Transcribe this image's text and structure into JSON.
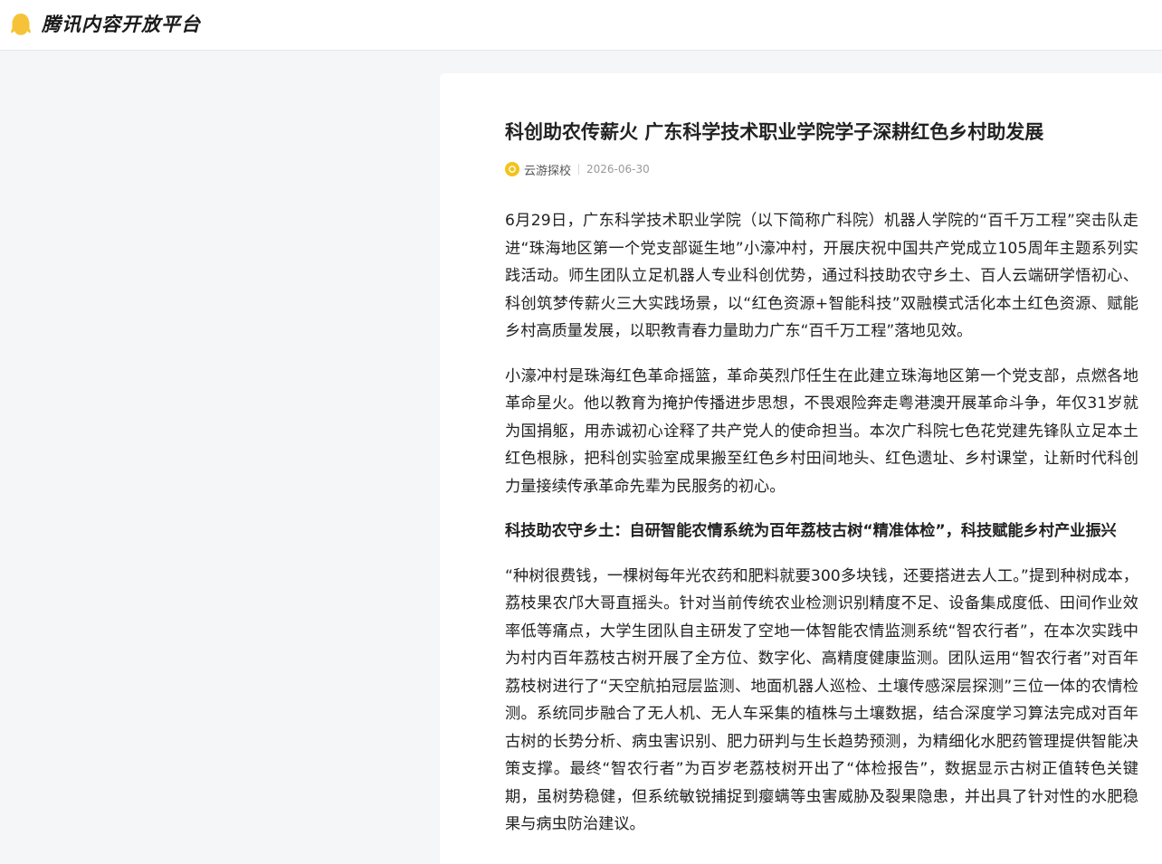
{
  "header": {
    "logo_text": "腾讯内容开放平台",
    "logo_icon": "penguin-icon",
    "brand_color": "#f6c338"
  },
  "article": {
    "title": "科创助农传薪火  广东科学技术职业学院学子深耕红色乡村助发展",
    "author": "云游探校",
    "date": "2026-06-30",
    "paragraphs": [
      "6月29日，广东科学技术职业学院（以下简称广科院）机器人学院的“百千万工程”突击队走进“珠海地区第一个党支部诞生地”小濠冲村，开展庆祝中国共产党成立105周年主题系列实践活动。师生团队立足机器人专业科创优势，通过科技助农守乡土、百人云端研学悟初心、科创筑梦传薪火三大实践场景，以“红色资源+智能科技”双融模式活化本土红色资源、赋能乡村高质量发展，以职教青春力量助力广东“百千万工程”落地见效。",
      "小濠冲村是珠海红色革命摇篮，革命英烈邝任生在此建立珠海地区第一个党支部，点燃各地革命星火。他以教育为掩护传播进步思想，不畏艰险奔走粤港澳开展革命斗争，年仅31岁就为国捐躯，用赤诚初心诠释了共产党人的使命担当。本次广科院七色花党建先锋队立足本土红色根脉，把科创实验室成果搬至红色乡村田间地头、红色遗址、乡村课堂，让新时代科创力量接续传承革命先辈为民服务的初心。",
      "科技助农守乡土：自研智能农情系统为百年荔枝古树“精准体检”，科技赋能乡村产业振兴",
      "“种树很费钱，一棵树每年光农药和肥料就要300多块钱，还要搭进去人工。”提到种树成本，荔枝果农邝大哥直摇头。针对当前传统农业检测识别精度不足、设备集成度低、田间作业效率低等痛点，大学生团队自主研发了空地一体智能农情监测系统“智农行者”，在本次实践中为村内百年荔枝古树开展了全方位、数字化、高精度健康监测。团队运用“智农行者”对百年荔枝树进行了“天空航拍冠层监测、地面机器人巡检、土壤传感深层探测”三位一体的农情检测。系统同步融合了无人机、无人车采集的植株与土壤数据，结合深度学习算法完成对百年古树的长势分析、病虫害识别、肥力研判与生长趋势预测，为精细化水肥药管理提供智能决策支撑。最终“智农行者”为百岁老荔枝树开出了“体检报告”，数据显示古树正值转色关键期，虽树势稳健，但系统敏锐捕捉到瘿螨等虫害威胁及裂果隐患，并出具了针对性的水肥稳果与病虫防治建议。"
    ]
  }
}
